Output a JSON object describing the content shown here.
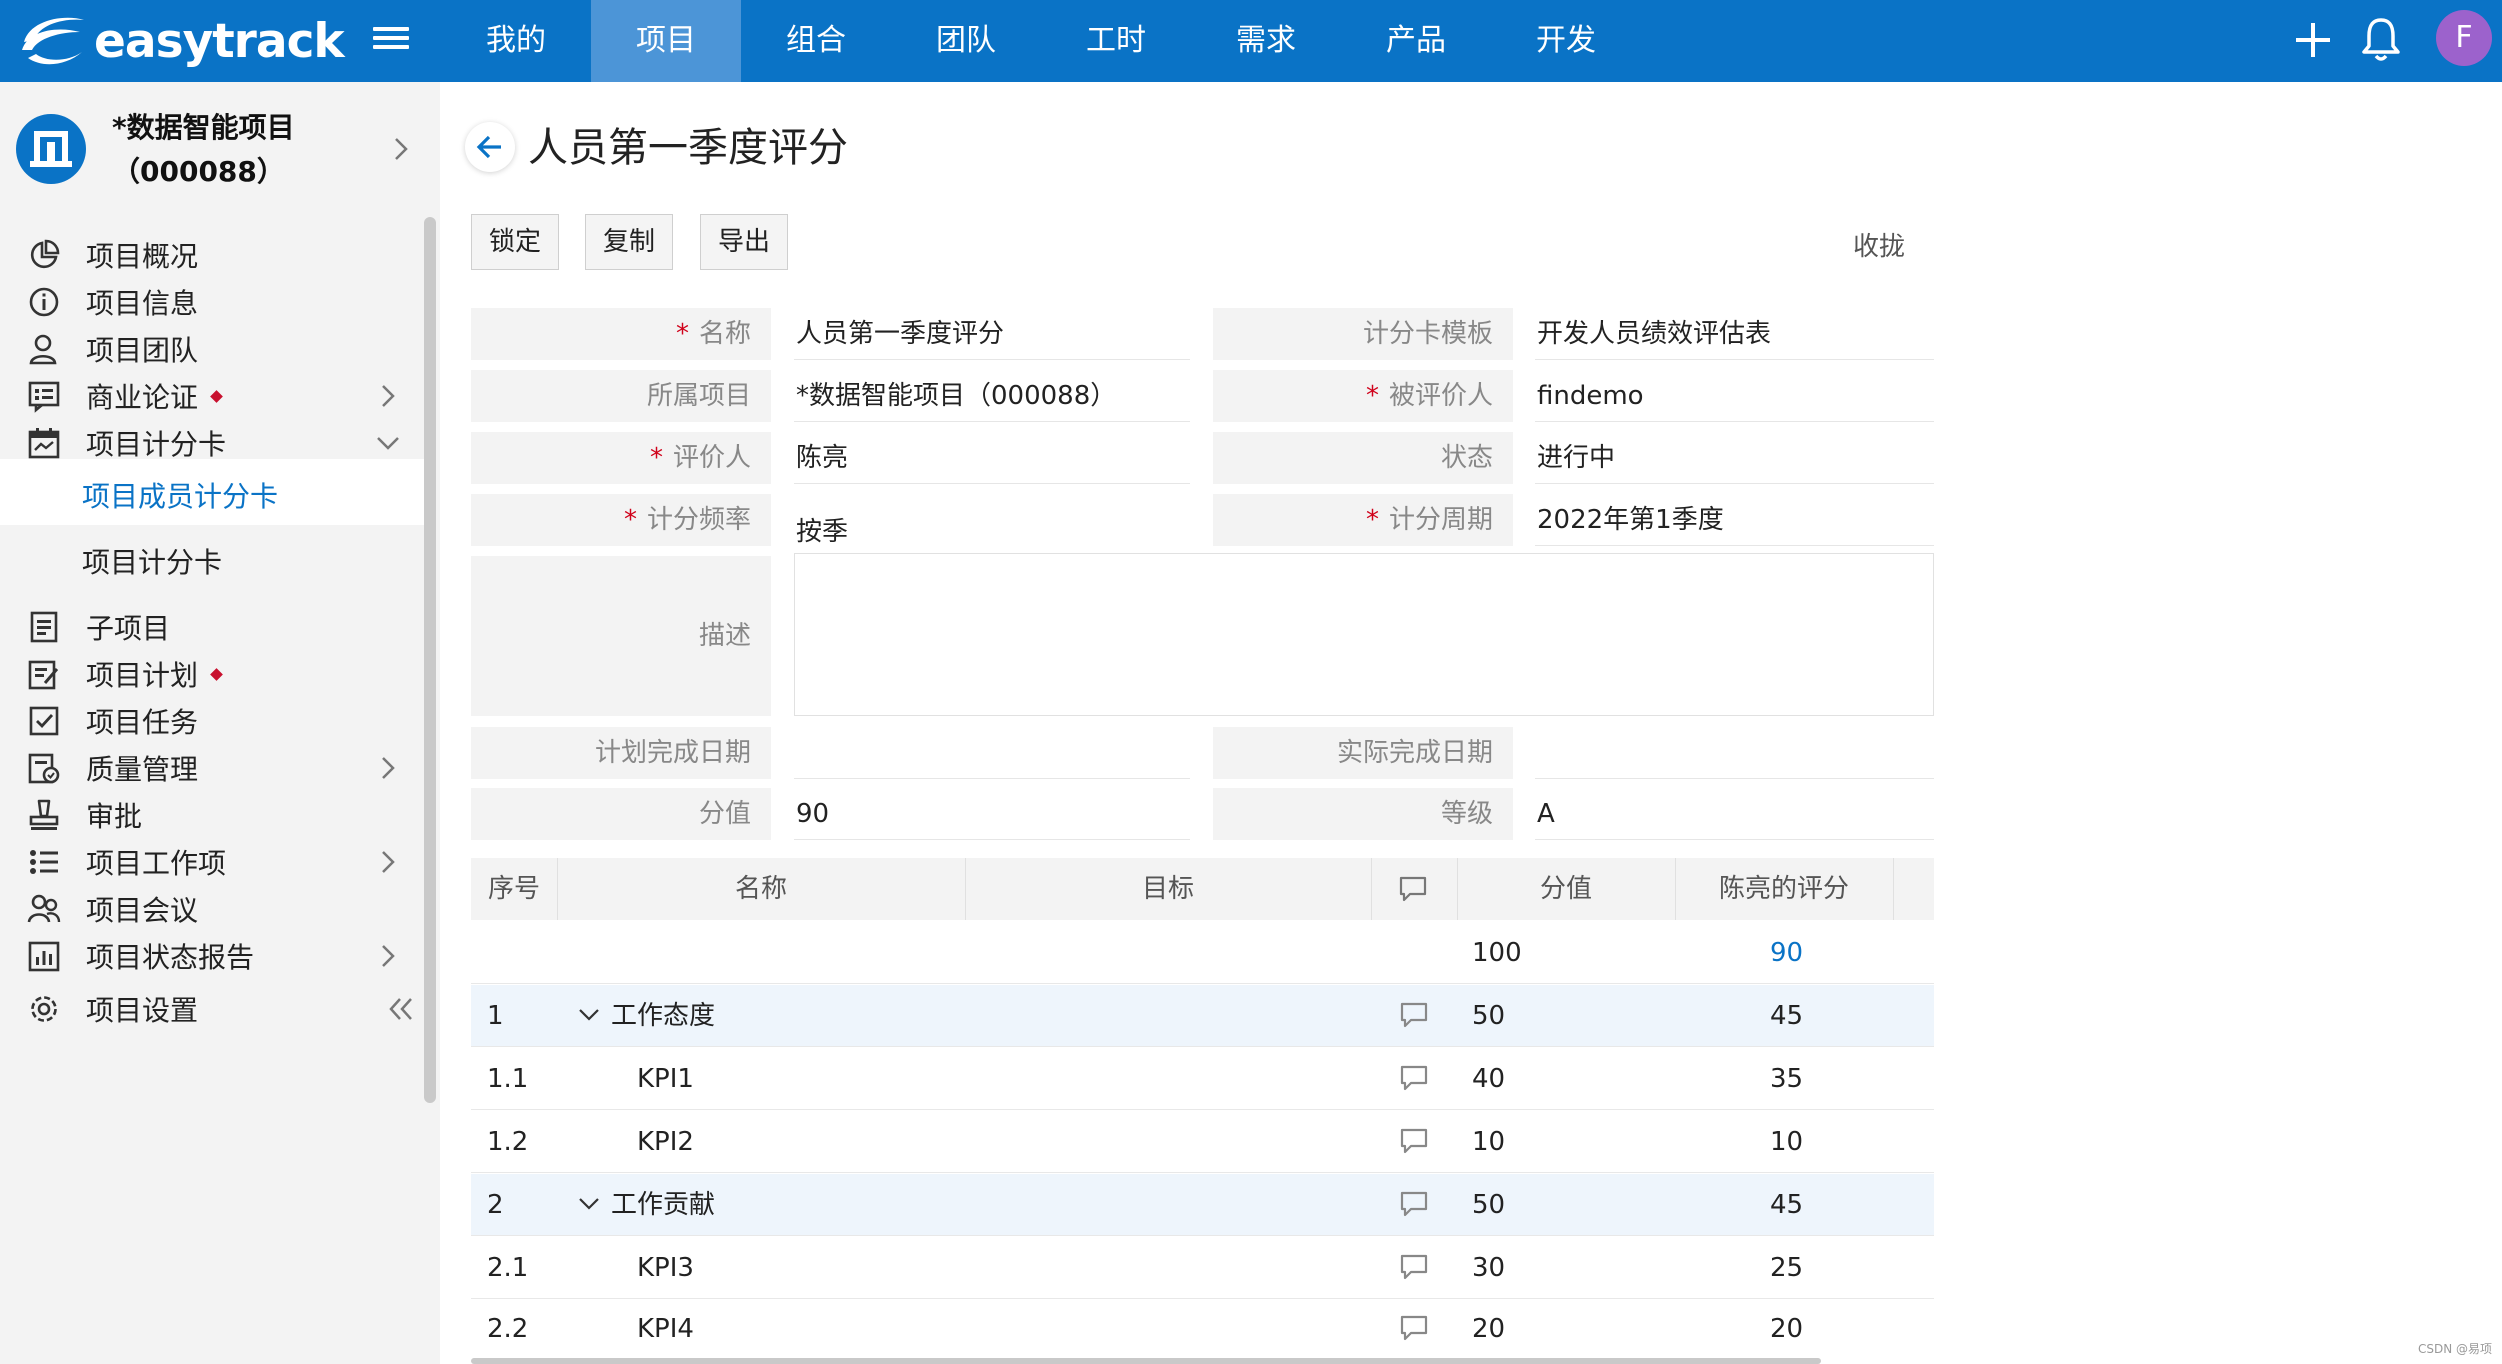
{
  "app": {
    "logo_text": "easytrack"
  },
  "nav": {
    "items": [
      "我的",
      "项目",
      "组合",
      "团队",
      "工时",
      "需求",
      "产品",
      "开发"
    ],
    "active_index": 1
  },
  "user": {
    "avatar_letter": "F"
  },
  "project": {
    "name": "*数据智能项目（000088）"
  },
  "sidebar": {
    "items": [
      {
        "label": "项目概况",
        "icon": "pie-chart-icon"
      },
      {
        "label": "项目信息",
        "icon": "info-icon"
      },
      {
        "label": "项目团队",
        "icon": "team-icon"
      },
      {
        "label": "商业论证",
        "icon": "business-case-icon",
        "badge": true,
        "expandable": true
      },
      {
        "label": "项目计分卡",
        "icon": "calendar-icon",
        "expanded": true
      },
      {
        "label": "子项目",
        "icon": "subproject-icon"
      },
      {
        "label": "项目计划",
        "icon": "plan-icon",
        "badge": true
      },
      {
        "label": "项目任务",
        "icon": "task-icon"
      },
      {
        "label": "质量管理",
        "icon": "quality-icon",
        "expandable": true
      },
      {
        "label": "审批",
        "icon": "approval-icon"
      },
      {
        "label": "项目工作项",
        "icon": "worklist-icon",
        "expandable": true
      },
      {
        "label": "项目会议",
        "icon": "meeting-icon"
      },
      {
        "label": "项目状态报告",
        "icon": "report-icon",
        "expandable": true
      },
      {
        "label": "项目设置",
        "icon": "settings-icon"
      }
    ],
    "subitems": [
      {
        "label": "项目成员计分卡",
        "active": true
      },
      {
        "label": "项目计分卡",
        "active": false
      }
    ]
  },
  "page": {
    "title": "人员第一季度评分",
    "buttons": {
      "lock": "锁定",
      "copy": "复制",
      "export": "导出"
    },
    "collapse": "收拢"
  },
  "form": {
    "name_label": "名称",
    "name_value": "人员第一季度评分",
    "template_label": "计分卡模板",
    "template_value": "开发人员绩效评估表",
    "project_label": "所属项目",
    "project_value": "*数据智能项目（000088）",
    "assessee_label": "被评价人",
    "assessee_value": "findemo",
    "assessor_label": "评价人",
    "assessor_value": "陈亮",
    "status_label": "状态",
    "status_value": "进行中",
    "frequency_label": "计分频率",
    "frequency_value": "按季",
    "period_label": "计分周期",
    "period_value": "2022年第1季度",
    "desc_label": "描述",
    "desc_value": "",
    "planned_date_label": "计划完成日期",
    "planned_date_value": "",
    "actual_date_label": "实际完成日期",
    "actual_date_value": "",
    "score_label": "分值",
    "score_value": "90",
    "grade_label": "等级",
    "grade_value": "A"
  },
  "table": {
    "headers": {
      "seq": "序号",
      "name": "名称",
      "target": "目标",
      "score": "分值",
      "rating": "陈亮的评分"
    },
    "total": {
      "score": "100",
      "rating": "90"
    },
    "rows": [
      {
        "seq": "1",
        "name": "工作态度",
        "score": "50",
        "rating": "45",
        "group": true
      },
      {
        "seq": "1.1",
        "name": "KPI1",
        "score": "40",
        "rating": "35",
        "group": false
      },
      {
        "seq": "1.2",
        "name": "KPI2",
        "score": "10",
        "rating": "10",
        "group": false
      },
      {
        "seq": "2",
        "name": "工作贡献",
        "score": "50",
        "rating": "45",
        "group": true
      },
      {
        "seq": "2.1",
        "name": "KPI3",
        "score": "30",
        "rating": "25",
        "group": false
      },
      {
        "seq": "2.2",
        "name": "KPI4",
        "score": "20",
        "rating": "20",
        "group": false
      }
    ]
  },
  "watermark": "CSDN @易项",
  "colors": {
    "brand": "#0a73c6",
    "nav_active": "#4c95d7",
    "required": "#d0021b",
    "badge": "#c8102e",
    "avatar": "#9c62cc"
  }
}
